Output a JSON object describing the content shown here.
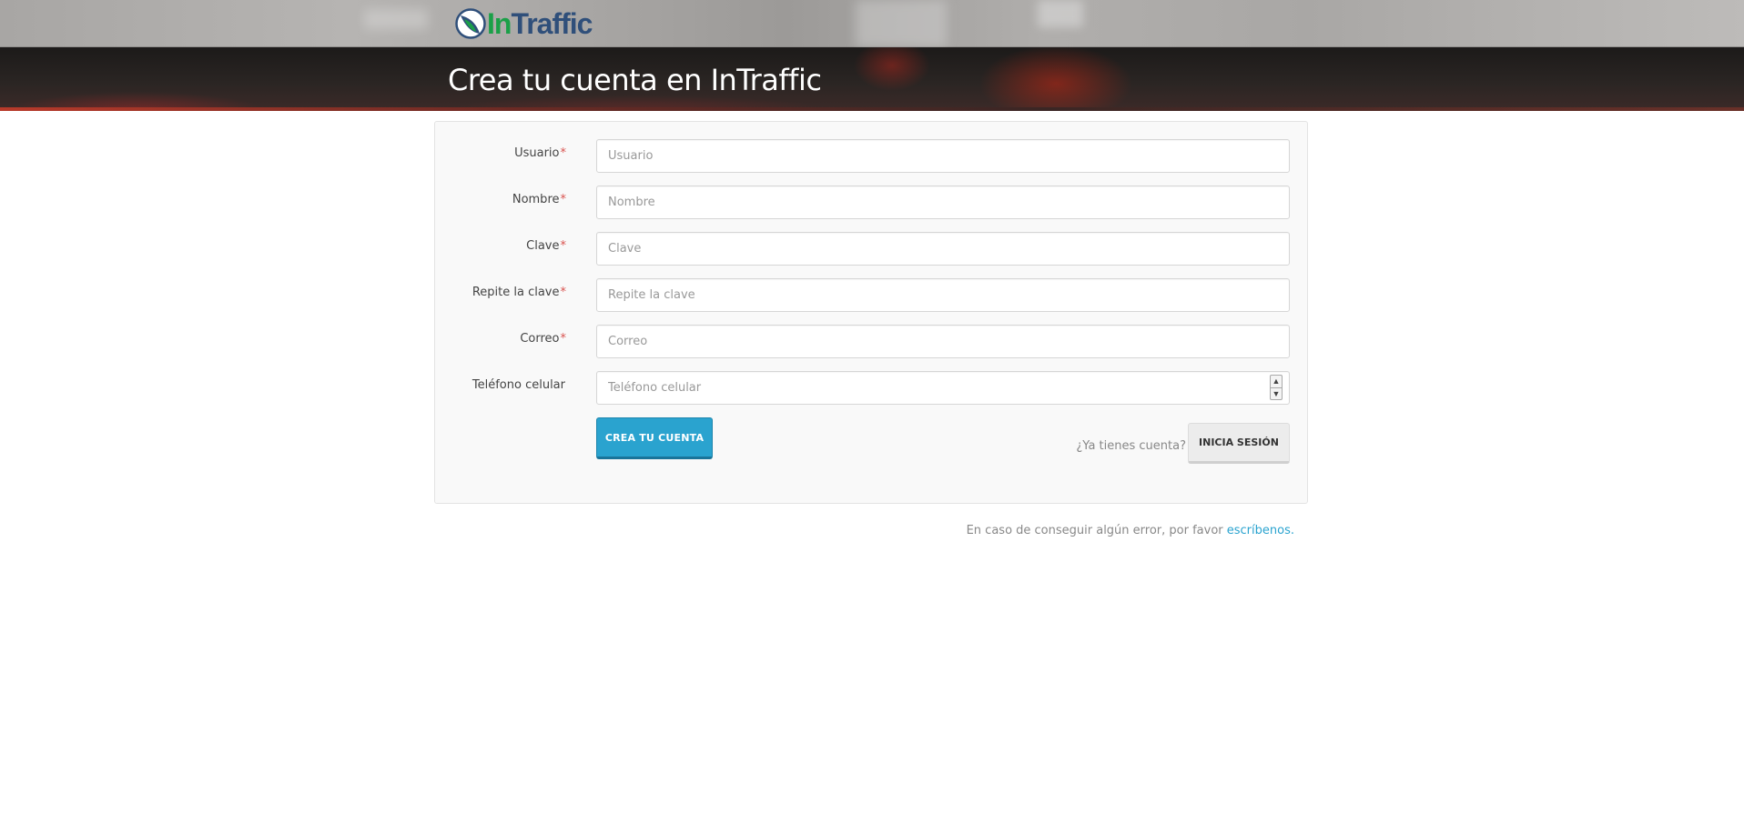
{
  "header": {
    "logo_prefix": "In",
    "logo_suffix": "Traffic",
    "logo_icon": "intraffic-logo-icon",
    "page_title": "Crea tu cuenta en InTraffic"
  },
  "form": {
    "fields": [
      {
        "label": "Usuario",
        "required": "*",
        "placeholder": "Usuario",
        "value": ""
      },
      {
        "label": "Nombre",
        "required": "*",
        "placeholder": "Nombre",
        "value": ""
      },
      {
        "label": "Clave",
        "required": "*",
        "placeholder": "Clave",
        "value": ""
      },
      {
        "label": "Repite la clave",
        "required": "*",
        "placeholder": "Repite la clave",
        "value": ""
      },
      {
        "label": "Correo",
        "required": "*",
        "placeholder": "Correo",
        "value": ""
      },
      {
        "label": "Teléfono celular",
        "required": "",
        "placeholder": "Teléfono celular",
        "value": ""
      }
    ],
    "submit_label": "CREA TU CUENTA",
    "have_account_text": "¿Ya tienes cuenta?",
    "login_label": "INICIA SESIÓN"
  },
  "footer": {
    "note_text": "En caso de conseguir algún error, por favor ",
    "link_text": "escríbenos."
  },
  "colors": {
    "accent": "#2aa3cf",
    "required": "#d9534f",
    "logo_green": "#1aa048",
    "logo_blue": "#2f4f7a"
  }
}
